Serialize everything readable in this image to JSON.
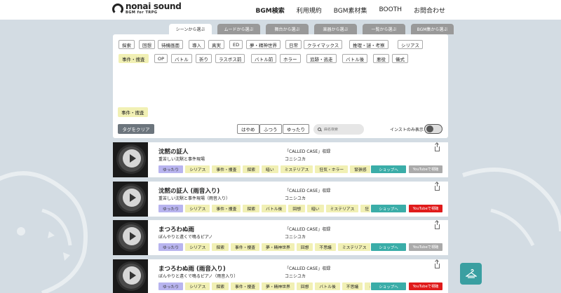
{
  "header": {
    "logo_text": "nonai sound",
    "logo_sub": "BGM for TRPG",
    "nav": [
      "BGM検索",
      "利用規約",
      "BGM素材集",
      "BOOTH",
      "お問合わせ"
    ]
  },
  "tabs": [
    "シーンから選ぶ",
    "ムードから選ぶ",
    "舞台から選ぶ",
    "楽器から選ぶ",
    "一覧から選ぶ",
    "BGM集から選ぶ"
  ],
  "tag_rows": [
    [
      "探索",
      "回想",
      "待機画面",
      "導入",
      "真実",
      "ED",
      "夢・精神世界",
      "日常",
      "クライマックス",
      "推理・謎・考察",
      "シリアス"
    ],
    [
      "事件・捜査",
      "OP",
      "バトル",
      "祈り",
      "ラスボス前",
      "バトル前",
      "ホラー",
      "追跡・逃走",
      "バトル後",
      "悪役",
      "儀式"
    ]
  ],
  "selected_tag": "事件・捜査",
  "clear_label": "タグをクリア",
  "speed_buttons": [
    "はやめ",
    "ふつう",
    "ゆったり"
  ],
  "search_placeholder": "曲名検索",
  "inst_label": "インストのみ表示",
  "shop_label": "ショップへ",
  "yt_label": "YouTubeで視聴",
  "colors": {
    "accent": "#3aada8",
    "yt_active": "#e01b1b",
    "yt_inactive": "#aaaaaa",
    "tag_yellow": "#f1f0b4",
    "tag_purple": "#b8b4ef"
  },
  "tracks": [
    {
      "title": "沈黙の証人",
      "subtitle": "重苦しい沈黙と事件現場",
      "album": "「CALLED CASE」収録",
      "artist": "コニシユカ",
      "tags": [
        "ゆったり",
        "シリアス",
        "事件・捜査",
        "探索",
        "暗い",
        "ミステリアス",
        "狂気・ホラー",
        "緊張感"
      ],
      "yt_active": false
    },
    {
      "title": "沈黙の証人 (雨音入り)",
      "subtitle": "重苦しい沈黙と事件現場（雨音入り）",
      "album": "「CALLED CASE」収録",
      "artist": "コニシユカ",
      "tags": [
        "ゆったり",
        "シリアス",
        "事件・捜査",
        "探索",
        "バトル後",
        "回想",
        "暗い",
        "ミステリアス",
        "狂"
      ],
      "yt_active": true
    },
    {
      "title": "まつろわぬ雨",
      "subtitle": "ぼんやりと遠くで鳴るピアノ",
      "album": "「CALLED CASE」収録",
      "artist": "コニシユカ",
      "tags": [
        "ゆったり",
        "シリアス",
        "探索",
        "事件・捜査",
        "夢・精神世界",
        "回想",
        "不思議",
        "ミステリアス"
      ],
      "yt_active": false
    },
    {
      "title": "まつろわぬ雨 (雨音入り)",
      "subtitle": "ぼんやりと遠くで鳴るピアノ（雨音入り）",
      "album": "「CALLED CASE」収録",
      "artist": "コニシユカ",
      "tags": [
        "ゆったり",
        "シリアス",
        "探索",
        "事件・捜査",
        "夢・精神世界",
        "回想",
        "バトル後",
        "不思議",
        "ミ"
      ],
      "yt_active": true
    }
  ]
}
